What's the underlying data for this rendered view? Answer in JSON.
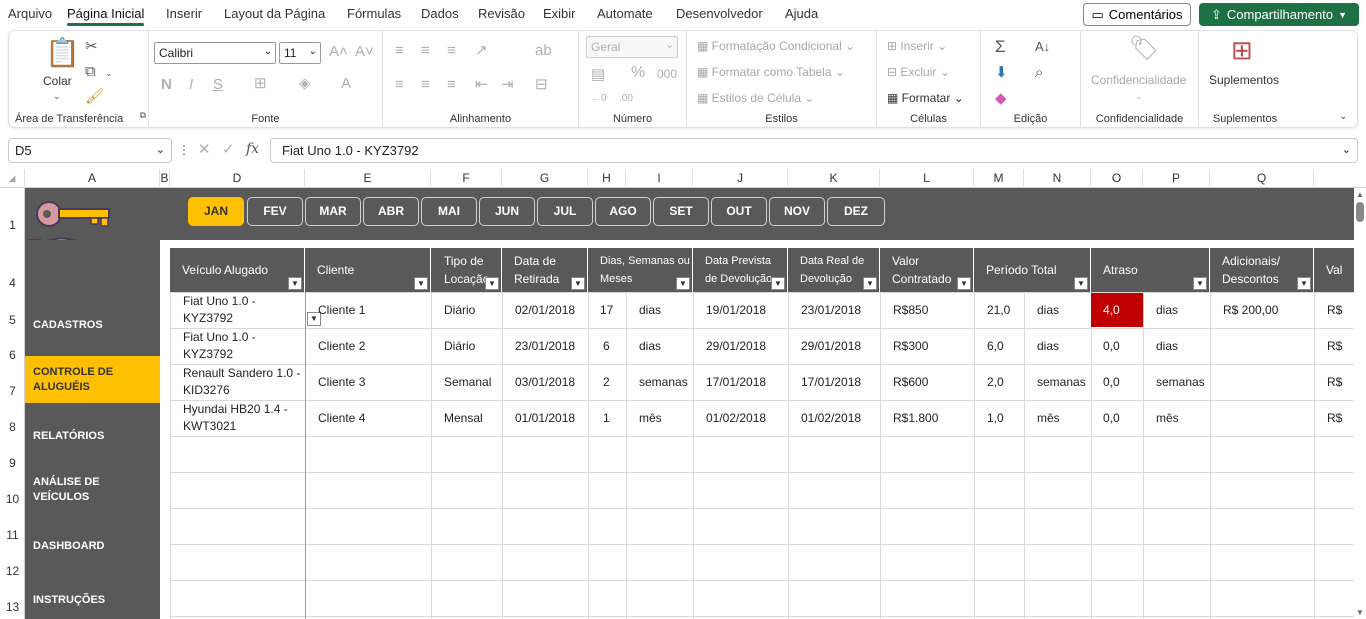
{
  "menu": {
    "tabs": [
      "Arquivo",
      "Página Inicial",
      "Inserir",
      "Layout da Página",
      "Fórmulas",
      "Dados",
      "Revisão",
      "Exibir",
      "Automate",
      "Desenvolvedor",
      "Ajuda"
    ],
    "comments_label": "Comentários",
    "share_label": "Compartilhamento"
  },
  "ribbon": {
    "clipboard": {
      "paste_label": "Colar",
      "group_label": "Área de Transferência"
    },
    "font": {
      "font_name": "Calibri",
      "font_size": "11",
      "group_label": "Fonte",
      "bold": "N",
      "italic": "I",
      "underline": "S"
    },
    "alignment": {
      "group_label": "Alinhamento"
    },
    "number": {
      "format": "Geral",
      "group_label": "Número"
    },
    "styles": {
      "conditional": "Formatação Condicional",
      "as_table": "Formatar como Tabela",
      "cell_styles": "Estilos de Célula",
      "group_label": "Estilos"
    },
    "cells": {
      "insert": "Inserir",
      "delete": "Excluir",
      "format": "Formatar",
      "group_label": "Células"
    },
    "editing": {
      "group_label": "Edição"
    },
    "sensitivity": {
      "label": "Confidencialidade",
      "group_label": "Confidencialidade"
    },
    "addins": {
      "label": "Suplementos",
      "group_label": "Suplementos"
    }
  },
  "formula_bar": {
    "name_box": "D5",
    "formula": "Fiat Uno 1.0 - KYZ3792"
  },
  "columns": [
    "A",
    "B",
    "D",
    "E",
    "F",
    "G",
    "H",
    "I",
    "J",
    "K",
    "L",
    "M",
    "N",
    "O",
    "P",
    "Q"
  ],
  "rows": [
    "1",
    "4",
    "5",
    "6",
    "7",
    "8",
    "9",
    "10",
    "11",
    "12",
    "13"
  ],
  "months": [
    "JAN",
    "FEV",
    "MAR",
    "ABR",
    "MAI",
    "JUN",
    "JUL",
    "AGO",
    "SET",
    "OUT",
    "NOV",
    "DEZ"
  ],
  "active_month": "JAN",
  "nav": [
    "CADASTROS",
    "CONTROLE DE ALUGUÉIS",
    "RELATÓRIOS",
    "ANÁLISE DE VEÍCULOS",
    "DASHBOARD",
    "INSTRUÇÕES"
  ],
  "active_nav": "CONTROLE DE ALUGUÉIS",
  "table": {
    "headers": [
      "Veículo Alugado",
      "Cliente",
      "Tipo de Locação",
      "Data de Retirada",
      "Dias, Semanas ou Meses",
      "Data Prevista de Devolução",
      "Data Real de Devolução",
      "Valor Contratado",
      "Período Total",
      "Atraso",
      "Adicionais/ Descontos",
      "Val"
    ],
    "rows": [
      {
        "veiculo": "Fiat Uno 1.0 - KYZ3792",
        "cliente": "Cliente 1",
        "tipo": "Diário",
        "retirada": "02/01/2018",
        "qtd": "17",
        "unidade": "dias",
        "prevista": "19/01/2018",
        "real": "23/01/2018",
        "valor": "R$850",
        "periodo": "21,0",
        "periodo_un": "dias",
        "atraso": "4,0",
        "atraso_un": "dias",
        "adicionais": "R$ 200,00",
        "val": "R$"
      },
      {
        "veiculo": "Fiat Uno 1.0 - KYZ3792",
        "cliente": "Cliente 2",
        "tipo": "Diário",
        "retirada": "23/01/2018",
        "qtd": "6",
        "unidade": "dias",
        "prevista": "29/01/2018",
        "real": "29/01/2018",
        "valor": "R$300",
        "periodo": "6,0",
        "periodo_un": "dias",
        "atraso": "0,0",
        "atraso_un": "dias",
        "adicionais": "",
        "val": "R$"
      },
      {
        "veiculo": "Renault Sandero 1.0 - KID3276",
        "cliente": "Cliente 3",
        "tipo": "Semanal",
        "retirada": "03/01/2018",
        "qtd": "2",
        "unidade": "semanas",
        "prevista": "17/01/2018",
        "real": "17/01/2018",
        "valor": "R$600",
        "periodo": "2,0",
        "periodo_un": "semanas",
        "atraso": "0,0",
        "atraso_un": "semanas",
        "adicionais": "",
        "val": "R$"
      },
      {
        "veiculo": "Hyundai HB20 1.4 - KWT3021",
        "cliente": "Cliente 4",
        "tipo": "Mensal",
        "retirada": "01/01/2018",
        "qtd": "1",
        "unidade": "mês",
        "prevista": "01/02/2018",
        "real": "01/02/2018",
        "valor": "R$1.800",
        "periodo": "1,0",
        "periodo_un": "mês",
        "atraso": "0,0",
        "atraso_un": "mês",
        "adicionais": "",
        "val": "R$"
      }
    ]
  },
  "colors": {
    "accent": "#fec000",
    "dark": "#595959",
    "late": "#c00000",
    "excel_green": "#1e7145"
  }
}
